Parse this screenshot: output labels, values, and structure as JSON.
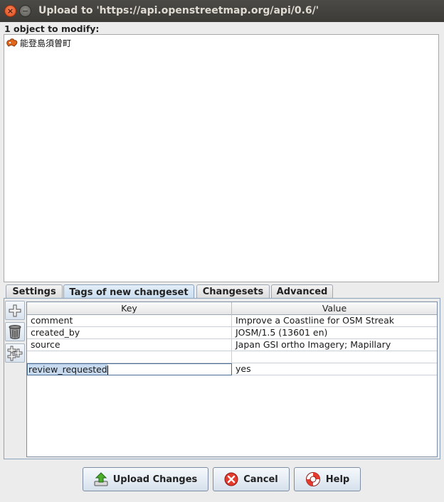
{
  "window": {
    "title": "Upload to 'https://api.openstreetmap.org/api/0.6/'",
    "close_glyph": "×",
    "minimize_glyph": "−"
  },
  "objects": {
    "heading": "1 object to modify:",
    "items": [
      {
        "name": "能登島須曽町",
        "icon": "relation-area-icon"
      }
    ]
  },
  "tabs": [
    {
      "label": "Settings",
      "active": false
    },
    {
      "label": "Tags of new changeset",
      "active": true
    },
    {
      "label": "Changesets",
      "active": false
    },
    {
      "label": "Advanced",
      "active": false
    }
  ],
  "tag_tools": [
    {
      "name": "add-tag-button",
      "icon": "plus-icon"
    },
    {
      "name": "delete-tag-button",
      "icon": "trash-icon"
    },
    {
      "name": "paste-tags-button",
      "icon": "multi-plus-icon"
    }
  ],
  "tag_table": {
    "columns": [
      "Key",
      "Value"
    ],
    "rows": [
      {
        "key": "comment",
        "value": "Improve a Coastline for OSM Streak"
      },
      {
        "key": "created_by",
        "value": "JOSM/1.5 (13601 en)"
      },
      {
        "key": "source",
        "value": "Japan GSI ortho Imagery; Mapillary"
      },
      {
        "key": "",
        "value": ""
      },
      {
        "key": "review_requested",
        "value": "yes",
        "editing": true
      }
    ]
  },
  "buttons": {
    "upload": "Upload Changes",
    "cancel": "Cancel",
    "help": "Help"
  },
  "colors": {
    "titlebar": "#3c3b37",
    "close": "#df4a16",
    "tab_active": "#c8dcef",
    "selection": "#c7d9ee"
  }
}
